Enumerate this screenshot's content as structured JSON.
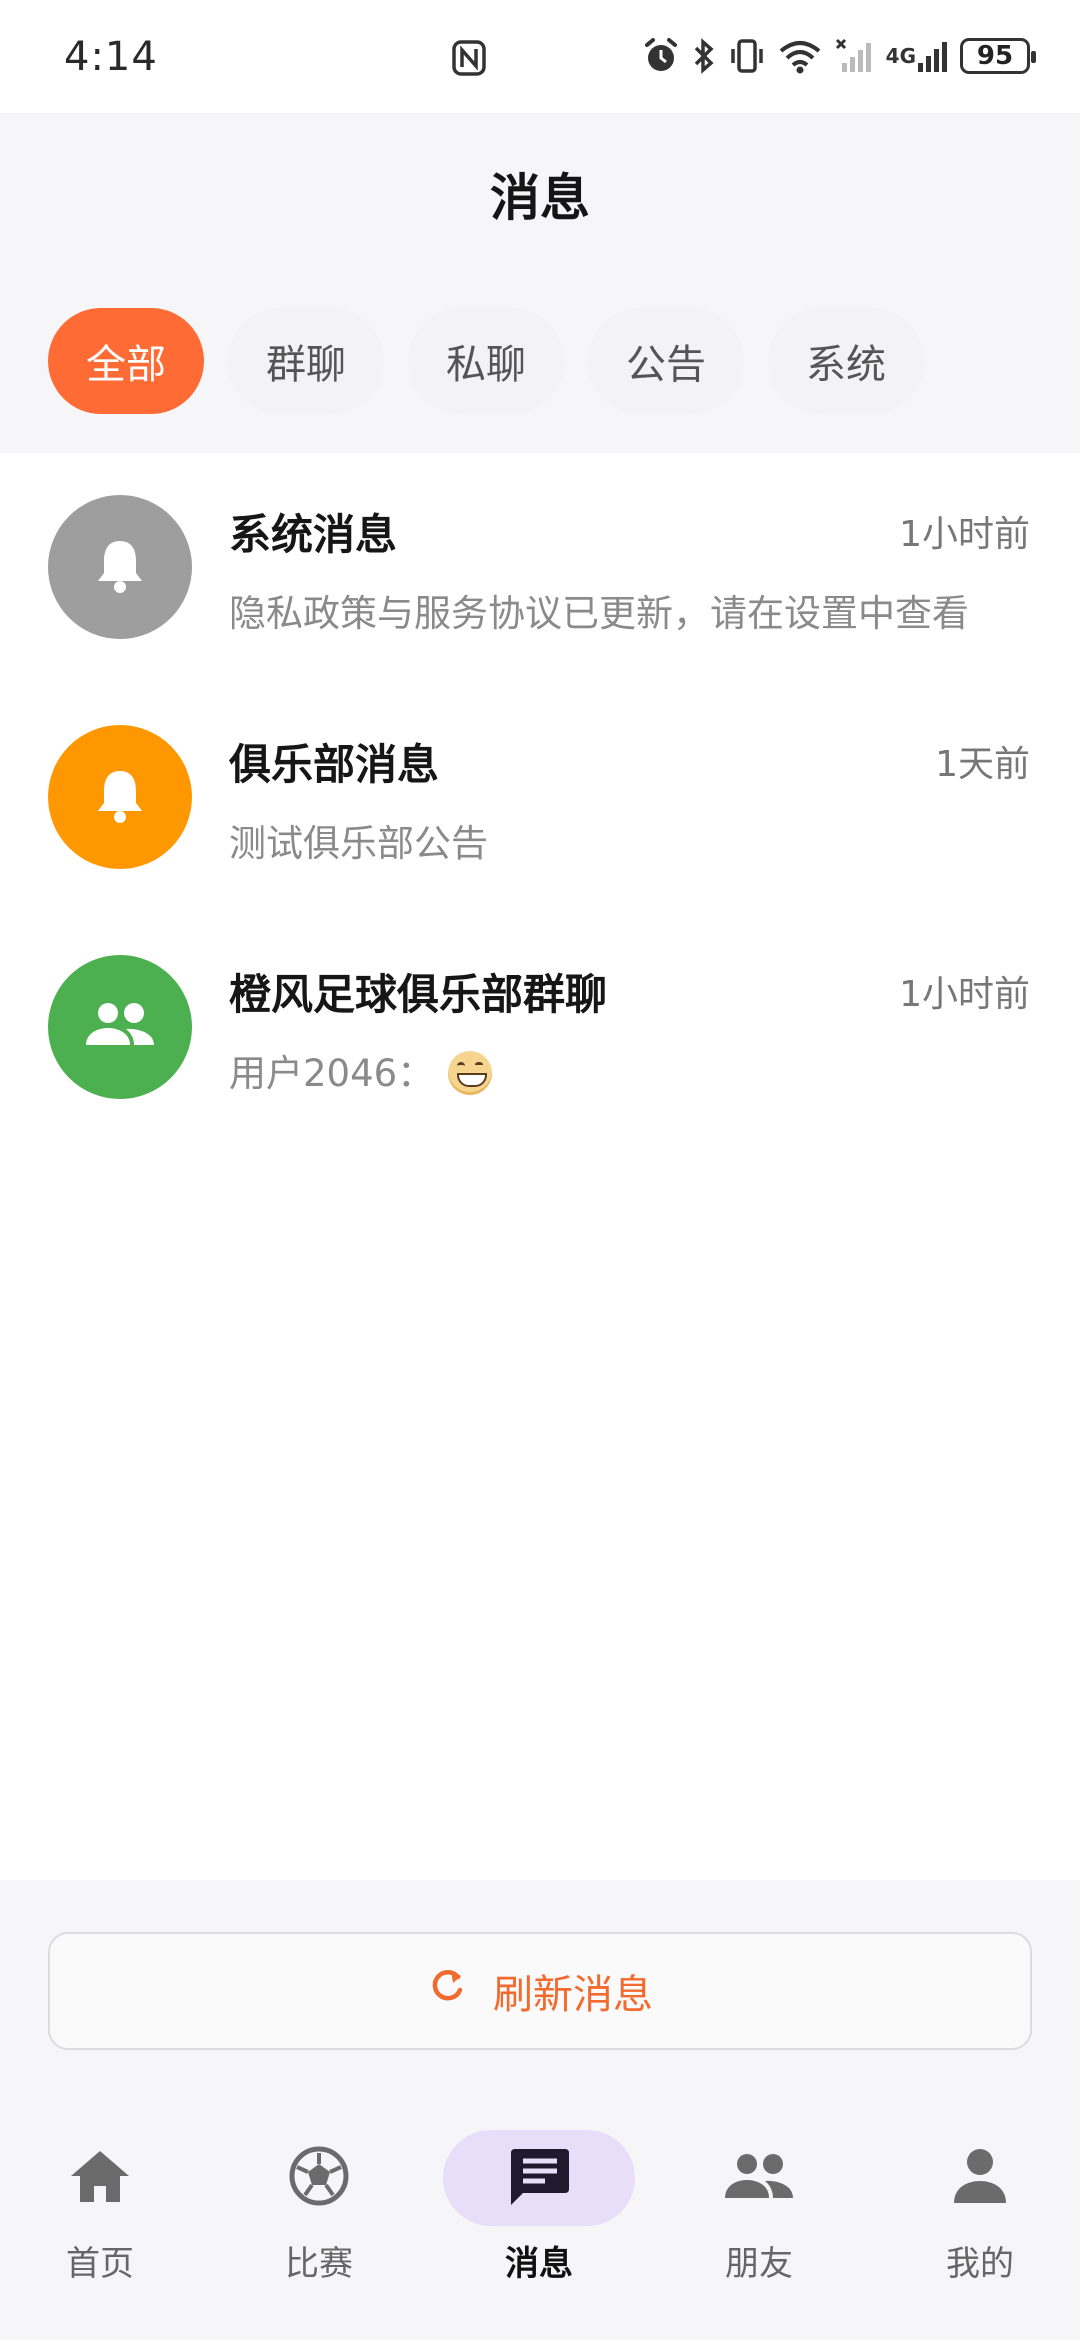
{
  "status_bar": {
    "time": "4:14",
    "battery": "95",
    "network": "4G",
    "icons": [
      "nfc-icon",
      "alarm-icon",
      "bluetooth-icon",
      "vibrate-icon",
      "wifi-icon",
      "signal-icon",
      "battery-icon"
    ]
  },
  "header": {
    "title": "消息",
    "tabs": [
      {
        "label": "全部",
        "active": true
      },
      {
        "label": "群聊",
        "active": false
      },
      {
        "label": "私聊",
        "active": false
      },
      {
        "label": "公告",
        "active": false
      },
      {
        "label": "系统",
        "active": false
      }
    ]
  },
  "messages": [
    {
      "title": "系统消息",
      "time": "1小时前",
      "preview": "隐私政策与服务协议已更新，请在设置中查看",
      "icon": "bell-icon",
      "color": "#9e9e9e"
    },
    {
      "title": "俱乐部消息",
      "time": "1天前",
      "preview": "测试俱乐部公告",
      "icon": "bell-icon",
      "color": "#ff9800"
    },
    {
      "title": "橙风足球俱乐部群聊",
      "time": "1小时前",
      "preview": "用户2046：",
      "icon": "group-icon",
      "color": "#4caf50"
    }
  ],
  "refresh": {
    "label": "刷新消息",
    "color": "#f26a2e"
  },
  "bottom_nav": [
    {
      "label": "首页",
      "icon": "home-icon",
      "active": false
    },
    {
      "label": "比赛",
      "icon": "soccer-ball-icon",
      "active": false
    },
    {
      "label": "消息",
      "icon": "chat-icon",
      "active": true
    },
    {
      "label": "朋友",
      "icon": "friends-icon",
      "active": false
    },
    {
      "label": "我的",
      "icon": "person-icon",
      "active": false
    }
  ],
  "colors": {
    "accent": "#ff6b35",
    "active_nav_bg": "#e9defa"
  }
}
